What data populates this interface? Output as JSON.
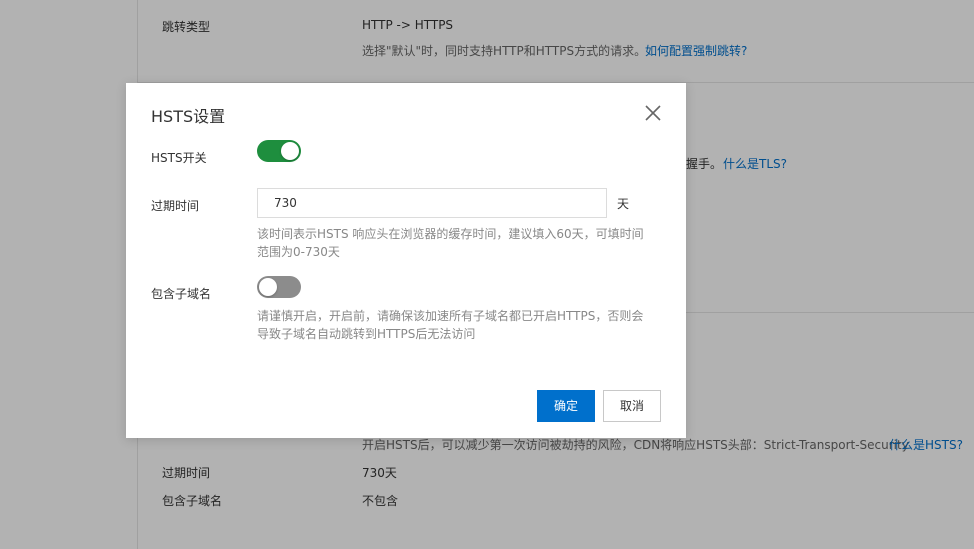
{
  "background": {
    "redirect_type_label": "跳转类型",
    "redirect_type_value": "HTTP -> HTTPS",
    "redirect_desc": "选择\"默认\"时，同时支持HTTP和HTTPS方式的请求。",
    "redirect_link": "如何配置强制跳转?",
    "tls_tail_text": "握手。",
    "tls_link": "什么是TLS?",
    "hsts_desc": "开启HSTS后，可以减少第一次访问被劫持的风险，CDN将响应HSTS头部：Strict-Transport-Security",
    "hsts_link": "什么是HSTS?",
    "expire_label": "过期时间",
    "expire_value": "730天",
    "subdomain_label": "包含子域名",
    "subdomain_value": "不包含"
  },
  "modal": {
    "title": "HSTS设置",
    "switch_label": "HSTS开关",
    "switch_on": true,
    "expire_label": "过期时间",
    "expire_value": "730",
    "expire_unit": "天",
    "expire_help": "该时间表示HSTS 响应头在浏览器的缓存时间，建议填入60天，可填时间范围为0-730天",
    "subdomain_label": "包含子域名",
    "subdomain_on": false,
    "subdomain_help": "请谨慎开启，开启前，请确保该加速所有子域名都已开启HTTPS，否则会导致子域名自动跳转到HTTPS后无法访问",
    "confirm_label": "确定",
    "cancel_label": "取消"
  },
  "colors": {
    "primary": "#0070cc",
    "toggle_on": "#1e8e3e",
    "toggle_off": "#8c8c8c"
  }
}
